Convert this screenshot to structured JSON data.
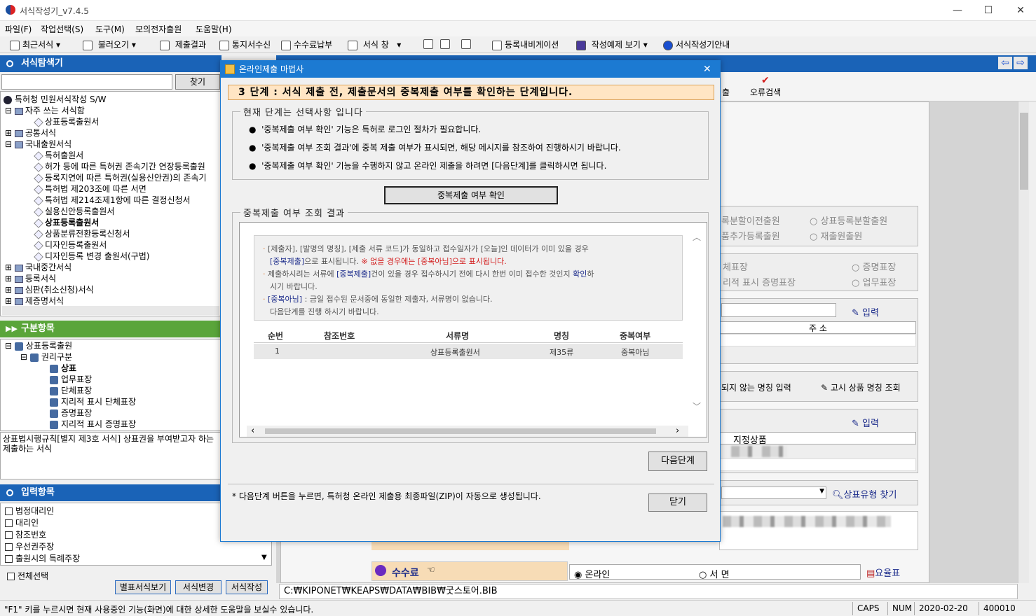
{
  "window": {
    "title": "서식작성기_v7.4.5",
    "min": "—",
    "max": "☐",
    "close": "✕"
  },
  "menu": [
    "파일(F)",
    "작업선택(S)",
    "도구(M)",
    "모의전자출원",
    "도움말(H)"
  ],
  "toolbar": {
    "recent": "최근서식",
    "load": "불러오기",
    "submit_result": "제출결과",
    "notice": "통지서수신",
    "fee": "수수료납부",
    "form_window": "서식 창",
    "nav": "등록내비게이션",
    "example": "작성예제 보기",
    "guide": "서식작성기안내"
  },
  "left": {
    "explorer_title": "서식탐색기",
    "find_button": "찾기",
    "tree": [
      "특허청 민원서식작성 S/W",
      "자주 쓰는 서식함",
      "상표등록출원서",
      "공통서식",
      "국내출원서식",
      "특허출원서",
      "허가 등에 따른 특허권 존속기간 연장등록출원",
      "등록지연에 따른 특허권(실용신안권)의 존속기",
      "특허법 제203조에 따른 서면",
      "특허법 제214조제1항에 따른 결정신청서",
      "실용신안등록출원서",
      "상표등록출원서",
      "상품분류전환등록신청서",
      "디자인등록출원서",
      "디자인등록 변경 출원서(구법)",
      "국내중간서식",
      "등록서식",
      "심판(취소신청)서식",
      "제증명서식"
    ],
    "category_title": "구분항목",
    "category_tree": [
      "상표등록출원",
      "권리구분",
      "상표",
      "업무표장",
      "단체표장",
      "지리적 표시 단체표장",
      "증명표장",
      "지리적 표시 증명표장"
    ],
    "description": "상표법시행규칙[별지 제3호 서식] 상표권을 부여받고자 하는 제출하는 서식",
    "input_title": "입력항목",
    "input_items": [
      "법정대리인",
      "대리인",
      "참조번호",
      "우선권주장",
      "출원시의 특례주장"
    ],
    "select_all": "전체선택",
    "btn_separate": "별표서식보기",
    "btn_change": "서식변경",
    "btn_write": "서식작성"
  },
  "right": {
    "error_check": "오류검색",
    "submit_tab": "출",
    "radio1": "록분할이전출원",
    "radio2": "상표등록분할출원",
    "radio3": "품추가등록출원",
    "radio4": "재출원출원",
    "mark1": "체표장",
    "mark2": "증명표장",
    "mark3": "리적 표시 증명표장",
    "mark4": "업무표장",
    "input1": "입력",
    "address": "주 소",
    "name_input": "되지 않는 명칭 입력",
    "notice_goods": "고시 상품 명칭 조회",
    "input2": "입력",
    "designated": "지정상품",
    "find_type": "상표유형 찾기",
    "fee_label": "수수료",
    "online": "온라인",
    "paper": "서 면",
    "fee_table": "요율표",
    "path": "C:₩KIPONET₩KEAPS₩DATA₩BIB₩굿스토어.BIB"
  },
  "dialog": {
    "title": "온라인제출 마법사",
    "step": "3 단계 : 서식 제출 전, 제출문서의 중복제출 여부를 확인하는 단계입니다.",
    "group1": "현재 단계는 선택사항 입니다",
    "bullets": [
      "'중복제출 여부 확인' 기능은 특허로 로그인 절차가 필요합니다.",
      "'중복제출 여부 조회 결과'에 중복 제출 여부가 표시되면, 해당 메시지를 참조하여 진행하시기 바랍니다.",
      "'중복제출 여부 확인' 기능을 수행하지 않고 온라인 제출을 하려면 [다음단계]를 클릭하시면 됩니다."
    ],
    "check_button": "중복제출 여부 확인",
    "group2": "중복제출 여부 조회 결과",
    "note1a": "[제출자], [발명의 명칭], [제출 서류 코드]가 동일하고 접수일자가 [오늘]인 데이터가 이미 있을 경우",
    "note1b": "[중복제출]",
    "note1c": "으로 표시됩니다.",
    "note1d": "※ 없을 경우에는 [중복아님]으로 표시됩니다.",
    "note2a": "제출하시려는 서류에",
    "note2b": "[중복제출]",
    "note2c": "건이 있을 경우 접수하시기 전에 다시 한번 이미 접수한 것인지",
    "note2d": "확인",
    "note2e": "하",
    "note2f": "시기 바랍니다.",
    "note3a": "[중복아님]",
    "note3b": ": 금일 접수된 문서중에 동일한 제출자, 서류명이 없습니다.",
    "note3c": "다음단계를 진행 하시기 바랍니다.",
    "columns": [
      "순번",
      "참조번호",
      "서류명",
      "명칭",
      "중복여부"
    ],
    "rows": [
      {
        "no": "1",
        "ref": "",
        "doc": "상표등록출원서",
        "name": "제35류",
        "dup": "중복아님"
      }
    ],
    "next_button": "다음단계",
    "footer_note": "* 다음단계 버튼을 누르면, 특허청 온라인 제출용 최종파일(ZIP)이 자동으로 생성됩니다.",
    "close_button": "닫기"
  },
  "status": {
    "help": "\"F1\" 키를 누르시면 현재 사용중인 기능(화면)에 대한 상세한 도움말을 보실수 있습니다.",
    "caps": "CAPS",
    "num": "NUM",
    "date": "2020-02-20",
    "code": "400010"
  },
  "colors": {
    "accent": "#1c7ad2",
    "panel_blue": "#1a63b7",
    "panel_green": "#5aa53a",
    "step_bg": "#ffe5c4"
  }
}
